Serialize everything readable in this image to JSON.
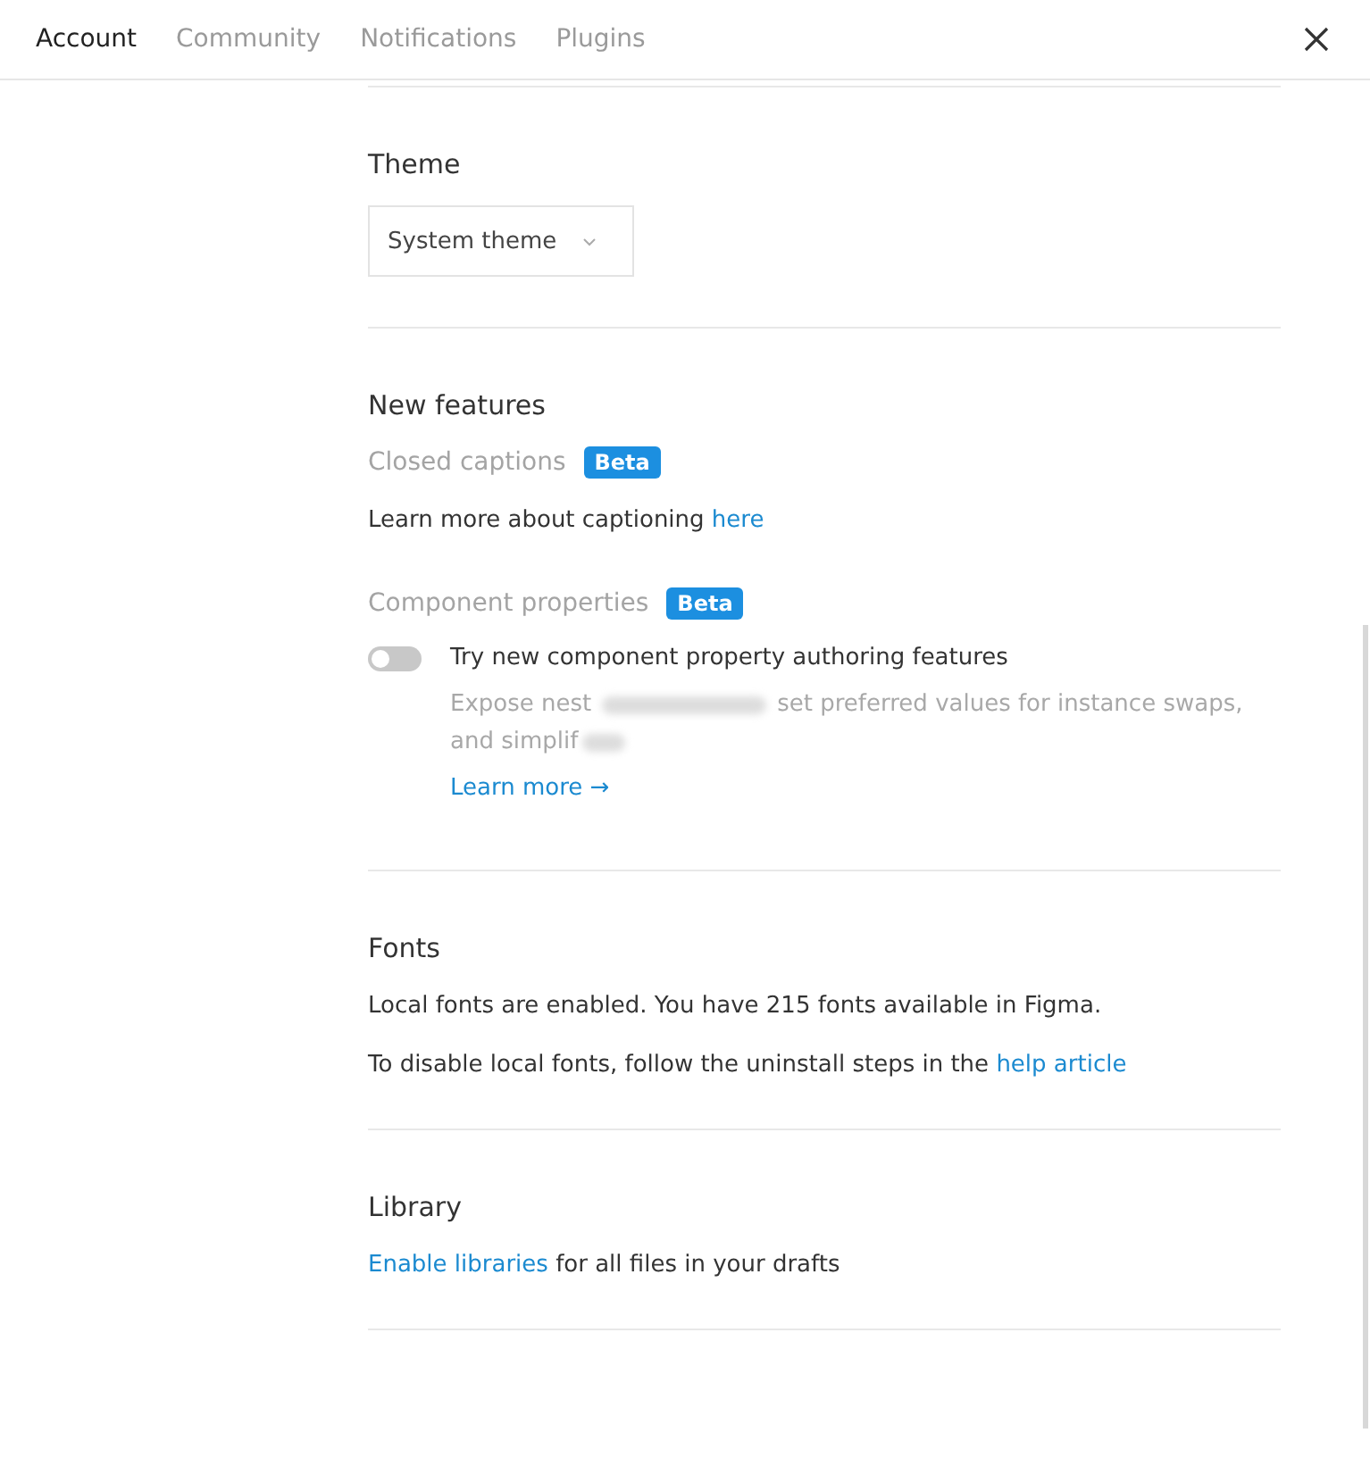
{
  "tabs": [
    {
      "label": "Account",
      "selected": true
    },
    {
      "label": "Community",
      "selected": false
    },
    {
      "label": "Notifications",
      "selected": false
    },
    {
      "label": "Plugins",
      "selected": false
    }
  ],
  "theme": {
    "title": "Theme",
    "dropdown": {
      "value": "System theme"
    }
  },
  "new_features": {
    "title": "New features",
    "closed_captions": {
      "label": "Closed captions",
      "badge": "Beta",
      "note": "Learn more about captioning",
      "link": "here"
    },
    "component_properties": {
      "label": "Component properties",
      "badge": "Beta",
      "toggle": {
        "label": "Try new component property authoring features",
        "on": false
      },
      "description_lines": [
        [
          "Expose nest",
          "set preferred values for instance swaps,"
        ],
        [
          "and simplif"
        ]
      ],
      "learn_more": "Learn more →"
    }
  },
  "fonts": {
    "title": "Fonts",
    "status": "Local fonts are enabled. You have 215 fonts available in Figma.",
    "hint": "To disable local fonts, follow the uninstall steps in the",
    "link": "help article"
  },
  "library": {
    "title": "Library",
    "link": "Enable libraries",
    "text": "for all files in your drafts"
  }
}
